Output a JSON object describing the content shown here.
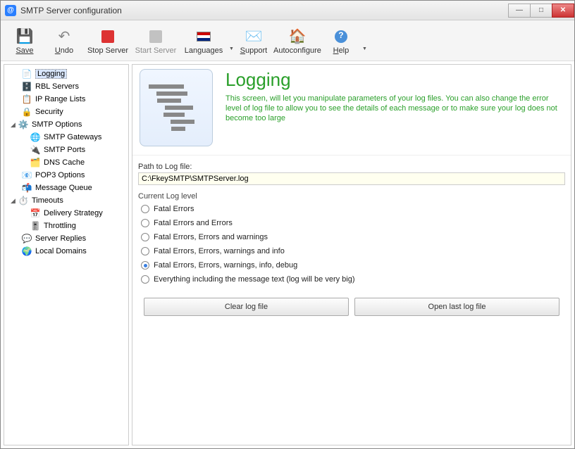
{
  "window": {
    "title": "SMTP Server configuration"
  },
  "toolbar": {
    "save": "Save",
    "undo": "Undo",
    "stopServer": "Stop Server",
    "startServer": "Start Server",
    "languages": "Languages",
    "support": "Support",
    "autoconfigure": "Autoconfigure",
    "help": "Help"
  },
  "tree": {
    "items": [
      {
        "label": "Logging",
        "level": 1,
        "selected": true
      },
      {
        "label": "RBL Servers",
        "level": 1
      },
      {
        "label": "IP Range Lists",
        "level": 1
      },
      {
        "label": "Security",
        "level": 1
      },
      {
        "label": "SMTP Options",
        "level": 0,
        "expanded": true
      },
      {
        "label": "SMTP Gateways",
        "level": 2
      },
      {
        "label": "SMTP Ports",
        "level": 2
      },
      {
        "label": "DNS Cache",
        "level": 2
      },
      {
        "label": "POP3 Options",
        "level": 0
      },
      {
        "label": "Message Queue",
        "level": 0
      },
      {
        "label": "Timeouts",
        "level": 0,
        "expanded": true
      },
      {
        "label": "Delivery Strategy",
        "level": 2
      },
      {
        "label": "Throttling",
        "level": 2
      },
      {
        "label": "Server Replies",
        "level": 0
      },
      {
        "label": "Local Domains",
        "level": 0
      }
    ]
  },
  "page": {
    "title": "Logging",
    "description": "This screen, will let you manipulate parameters of your log files. You can also change the error level of log file to allow you to see the details of each message or to make sure your log does not become too large",
    "pathLabel": "Path to Log file:",
    "pathValue": "C:\\FkeySMTP\\SMTPServer.log",
    "logLevelLabel": "Current Log level",
    "radios": [
      {
        "label": "Fatal Errors",
        "checked": false
      },
      {
        "label": "Fatal Errors and Errors",
        "checked": false
      },
      {
        "label": "Fatal Errors, Errors and warnings",
        "checked": false
      },
      {
        "label": "Fatal Errors, Errors, warnings and  info",
        "checked": false
      },
      {
        "label": "Fatal Errors, Errors, warnings, info, debug",
        "checked": true
      },
      {
        "label": "Everything including the message text (log will be very big)",
        "checked": false
      }
    ],
    "clearBtn": "Clear log file",
    "openBtn": "Open last log file"
  }
}
